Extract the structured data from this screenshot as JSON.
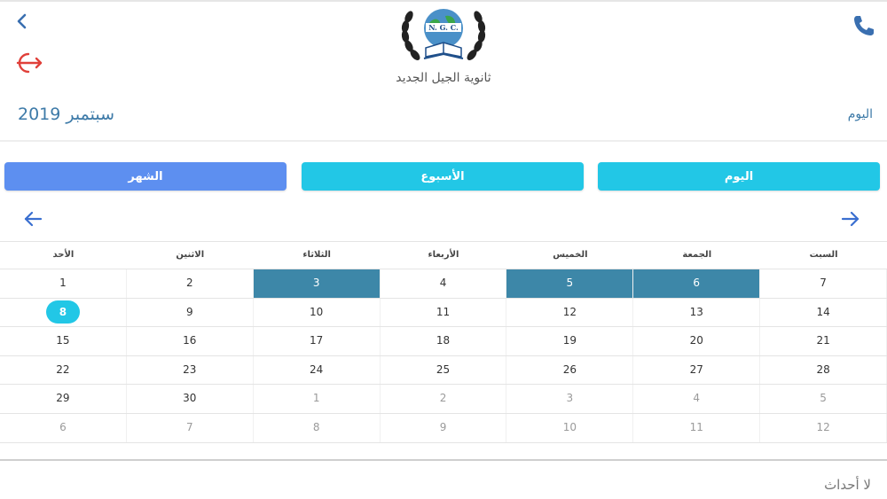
{
  "colors": {
    "accent_blue": "#5d8ff0",
    "accent_cyan": "#22c7e6",
    "event_fill": "#3d87a8",
    "title_blue": "#3d7aa8",
    "logout_red": "#e0403a"
  },
  "icons": {
    "back": "chevron-left-icon",
    "logout": "logout-icon",
    "phone": "phone-icon",
    "prev": "arrow-left-icon",
    "next": "arrow-right-icon"
  },
  "header": {
    "school_name": "ثانوية الجيل الجديد",
    "logo_text": "N. G. C.",
    "month_title": "سبتمبر 2019",
    "today_link": "اليوم"
  },
  "views": {
    "month": "الشهر",
    "week": "الأسبوع",
    "day": "اليوم"
  },
  "calendar": {
    "weekdays": [
      "الأحد",
      "الاثنين",
      "الثلاثاء",
      "الأربعاء",
      "الخميس",
      "الجمعة",
      "السبت"
    ],
    "weeks": [
      [
        "1",
        "2",
        "3",
        "4",
        "5",
        "6",
        "7"
      ],
      [
        "8",
        "9",
        "10",
        "11",
        "12",
        "13",
        "14"
      ],
      [
        "15",
        "16",
        "17",
        "18",
        "19",
        "20",
        "21"
      ],
      [
        "22",
        "23",
        "24",
        "25",
        "26",
        "27",
        "28"
      ],
      [
        "29",
        "30",
        "1",
        "2",
        "3",
        "4",
        "5"
      ],
      [
        "6",
        "7",
        "8",
        "9",
        "10",
        "11",
        "12"
      ]
    ]
  },
  "footer": {
    "no_events": "لا أحداث"
  }
}
